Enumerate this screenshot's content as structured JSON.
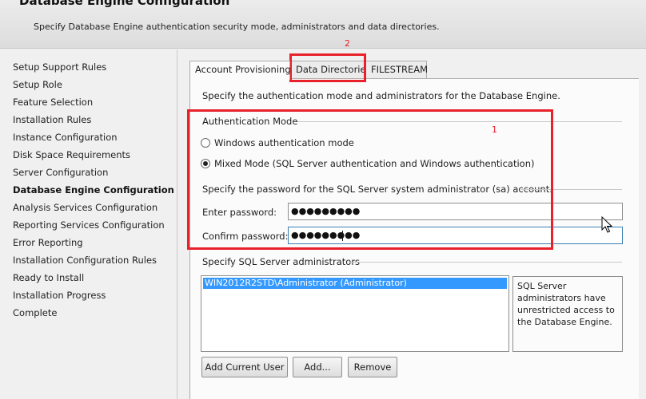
{
  "header": {
    "title": "Database Engine Configuration",
    "description": "Specify Database Engine authentication security mode, administrators and data directories."
  },
  "nav": {
    "items": [
      "Setup Support Rules",
      "Setup Role",
      "Feature Selection",
      "Installation Rules",
      "Instance Configuration",
      "Disk Space Requirements",
      "Server Configuration",
      "Database Engine Configuration",
      "Analysis Services Configuration",
      "Reporting Services Configuration",
      "Error Reporting",
      "Installation Configuration Rules",
      "Ready to Install",
      "Installation Progress",
      "Complete"
    ],
    "active": "Database Engine Configuration"
  },
  "tabs": {
    "account_provisioning": "Account Provisioning",
    "data_directories": "Data Directories",
    "filestream": "FILESTREAM"
  },
  "panel": {
    "intro": "Specify the authentication mode and administrators for the Database Engine.",
    "auth_group_label": "Authentication Mode",
    "radio_windows": "Windows authentication mode",
    "radio_mixed": "Mixed Mode (SQL Server authentication and Windows authentication)",
    "password_prompt": "Specify the password for the SQL Server system administrator (sa) account.",
    "enter_password_label": "Enter password:",
    "enter_password_value": "●●●●●●●●●",
    "confirm_password_label": "Confirm password:",
    "confirm_password_value": "●●●●●●●●●",
    "admins_group_label": "Specify SQL Server administrators",
    "admins": [
      "WIN2012R2STD\\Administrator (Administrator)"
    ],
    "admins_info": "SQL Server administrators have unrestricted access to the Database Engine.",
    "btn_add_current_user": "Add Current User",
    "btn_add": "Add...",
    "btn_remove": "Remove"
  },
  "annotations": {
    "label_1": "1",
    "label_2": "2",
    "color": "#e8212b"
  }
}
